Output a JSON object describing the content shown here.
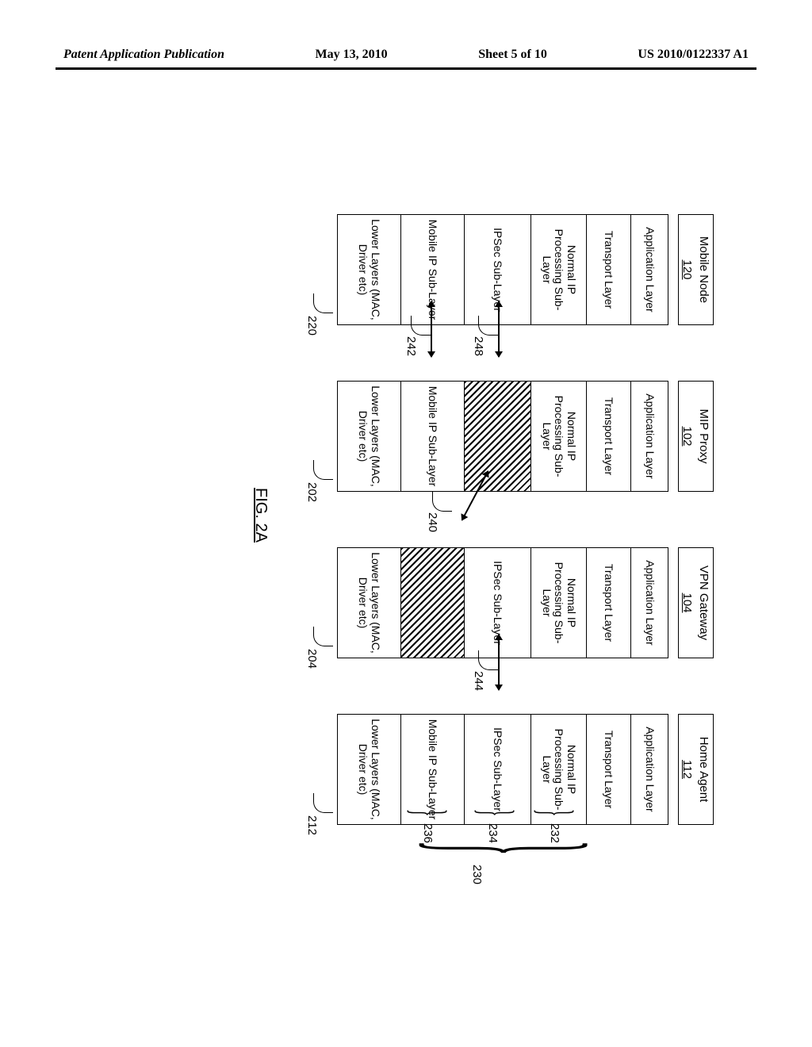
{
  "header": {
    "left": "Patent Application Publication",
    "date": "May 13, 2010",
    "sheet": "Sheet 5 of 10",
    "pubnum": "US 2010/0122337 A1"
  },
  "figure_label": "FIG. 2A",
  "nodes": [
    {
      "title": "Mobile Node",
      "id": "120",
      "stack_ref": "220"
    },
    {
      "title": "MIP Proxy",
      "id": "102",
      "stack_ref": "202"
    },
    {
      "title": "VPN Gateway",
      "id": "104",
      "stack_ref": "204"
    },
    {
      "title": "Home Agent",
      "id": "112",
      "stack_ref": "212"
    }
  ],
  "layer_names": {
    "app": "Application Layer",
    "trans": "Transport Layer",
    "nip": "Normal IP Processing Sub-Layer",
    "ipsec": "IPSec Sub-Layer",
    "mip": "Mobile IP Sub-Layer",
    "low": "Lower Layers (MAC, Driver etc)"
  },
  "bracket_group": {
    "ref": "230",
    "items": [
      "232",
      "234",
      "236"
    ]
  },
  "arrows": [
    {
      "ref": "248",
      "from": "mobile-node.ipsec",
      "to": "mip-proxy.ipsec"
    },
    {
      "ref": "242",
      "from": "mobile-node.mip",
      "to": "mip-proxy.mip"
    },
    {
      "ref": "240",
      "from": "mip-proxy.ipsec",
      "to": "vpn-gateway.mip-area"
    },
    {
      "ref": "244",
      "from": "vpn-gateway.ipsec",
      "to": "home-agent.ipsec"
    }
  ]
}
